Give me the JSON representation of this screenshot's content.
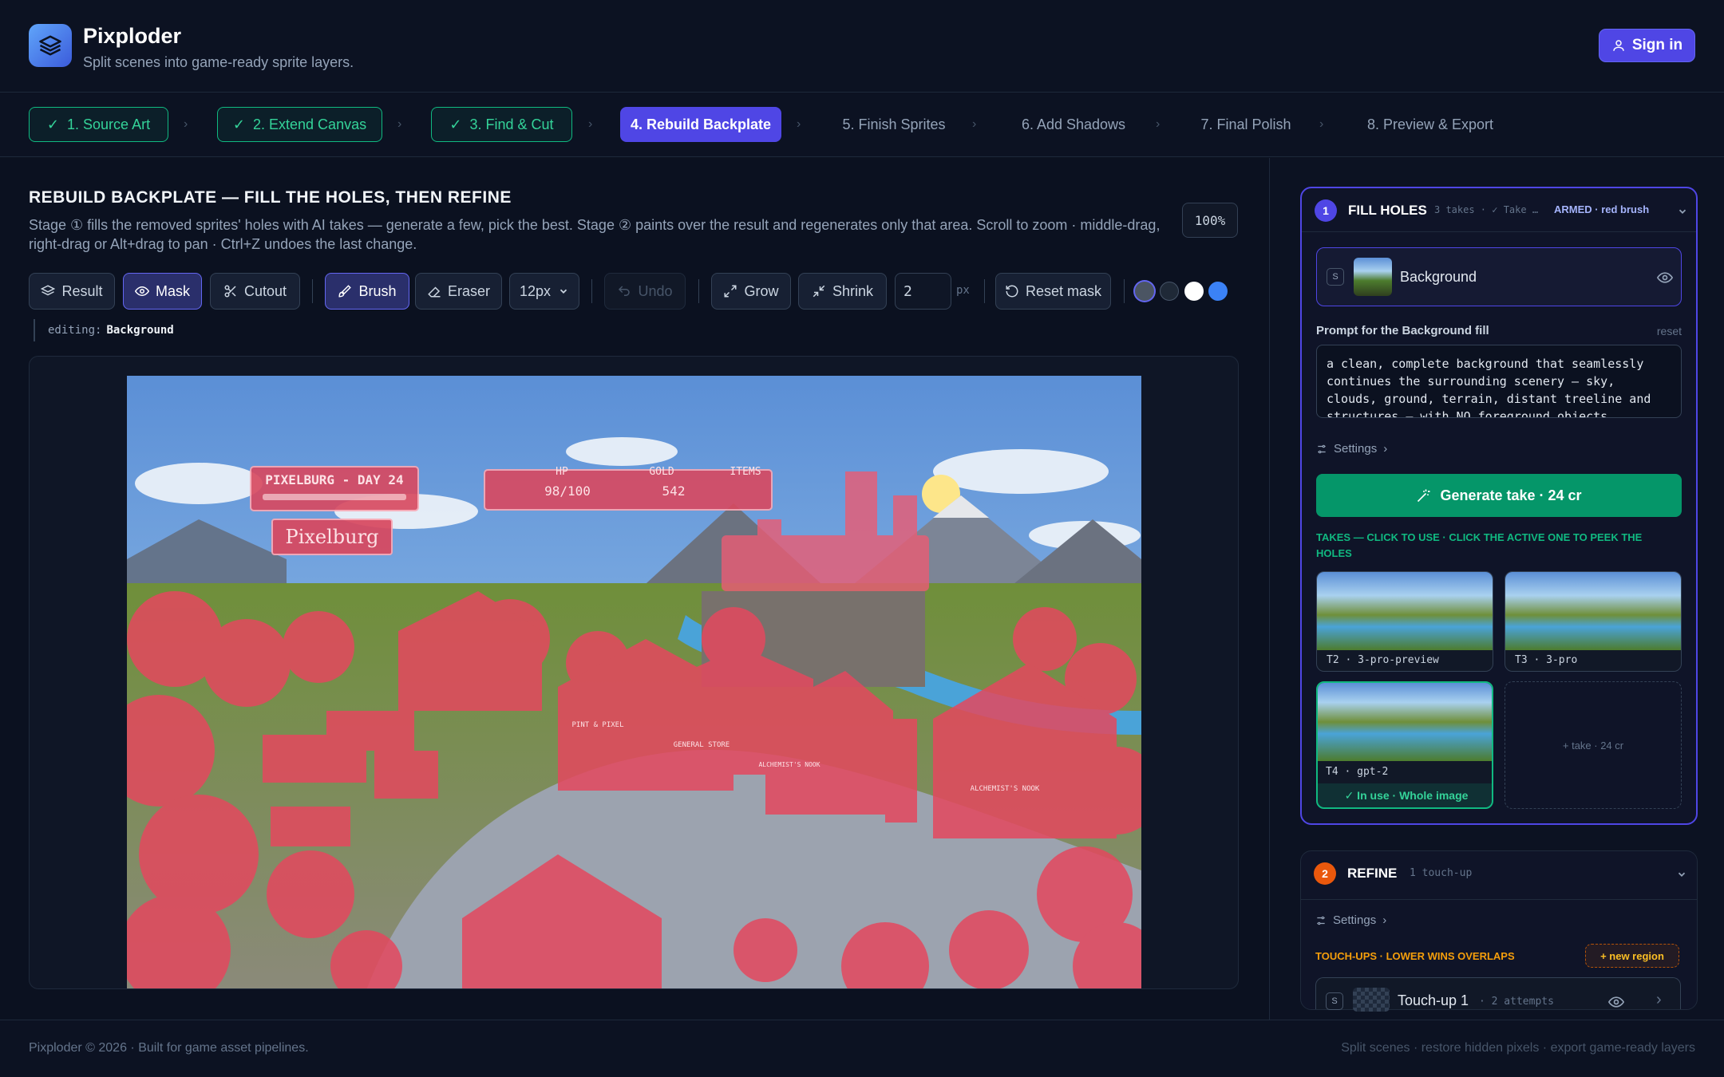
{
  "app": {
    "name": "Pixploder",
    "tagline": "Split scenes into game-ready sprite layers.",
    "signin": "Sign in",
    "logo_icon": "layers-icon"
  },
  "steps": [
    {
      "label": "1. Source Art",
      "state": "done"
    },
    {
      "label": "2. Extend Canvas",
      "state": "done"
    },
    {
      "label": "3. Find & Cut",
      "state": "done"
    },
    {
      "label": "4. Rebuild Backplate",
      "state": "active"
    },
    {
      "label": "5. Finish Sprites",
      "state": "todo"
    },
    {
      "label": "6. Add Shadows",
      "state": "todo"
    },
    {
      "label": "7. Final Polish",
      "state": "todo"
    },
    {
      "label": "8. Preview & Export",
      "state": "todo"
    }
  ],
  "page": {
    "title": "REBUILD BACKPLATE — FILL THE HOLES, THEN REFINE",
    "desc": "Stage ① fills the removed sprites' holes with AI takes — generate a few, pick the best. Stage ② paints over the result and regenerates only that area. Scroll to zoom · middle-drag, right-drag or Alt+drag to pan · Ctrl+Z undoes the last change.",
    "zoom": "100%"
  },
  "toolbar": {
    "result": "Result",
    "mask": "Mask",
    "cutout": "Cutout",
    "brush": "Brush",
    "eraser": "Eraser",
    "brush_size": "12px",
    "undo": "Undo",
    "grow": "Grow",
    "shrink": "Shrink",
    "px_value": "2",
    "px_unit": "px",
    "reset": "Reset mask",
    "swatches": [
      "#4b5563",
      "#1f2937",
      "#ffffff",
      "#3b82f6"
    ]
  },
  "editing": {
    "label": "editing:",
    "value": "Background"
  },
  "scene": {
    "hud_town": "PIXELBURG - DAY 24",
    "hud_hp_label": "HP",
    "hud_hp": "98/100",
    "hud_gold_label": "GOLD",
    "hud_gold": "542",
    "hud_items_label": "ITEMS",
    "sign": "Pixelburg",
    "shop1": "PINT & PIXEL",
    "shop2": "GENERAL STORE",
    "shop3": "ALCHEMIST'S NOOK",
    "shop4": "ALCHEMIST'S NOOK"
  },
  "fill": {
    "num": "1",
    "title": "FILL HOLES",
    "meta": "3 takes · ✓ Take …",
    "armed": "ARMED · red brush",
    "layer_badge": "S",
    "layer_name": "Background",
    "prompt_label": "Prompt for the Background fill",
    "reset": "reset",
    "prompt": "a clean, complete background that seamlessly continues the surrounding scenery — sky, clouds, ground, terrain, distant treeline and structures — with NO foreground objects",
    "settings": "Settings",
    "generate": "Generate take · 24 cr",
    "takes_label": "TAKES — CLICK TO USE · CLICK THE ACTIVE ONE TO PEEK THE HOLES",
    "takes": [
      {
        "label": "T2 · 3-pro-preview"
      },
      {
        "label": "T3 · 3-pro"
      },
      {
        "label": "T4 · gpt-2",
        "status": "✓ In use · Whole image"
      }
    ],
    "add_take": "+ take · 24 cr"
  },
  "refine": {
    "num": "2",
    "title": "REFINE",
    "meta": "1 touch-up",
    "settings": "Settings",
    "touchups_label": "TOUCH-UPS · LOWER WINS OVERLAPS",
    "new_region": "+ new region",
    "item_badge": "S",
    "item_name": "Touch-up 1",
    "item_meta": "· 2 attempts"
  },
  "footer": {
    "left": "Pixploder © 2026 · Built for game asset pipelines.",
    "right": "Split scenes · restore hidden pixels · export game-ready layers"
  }
}
